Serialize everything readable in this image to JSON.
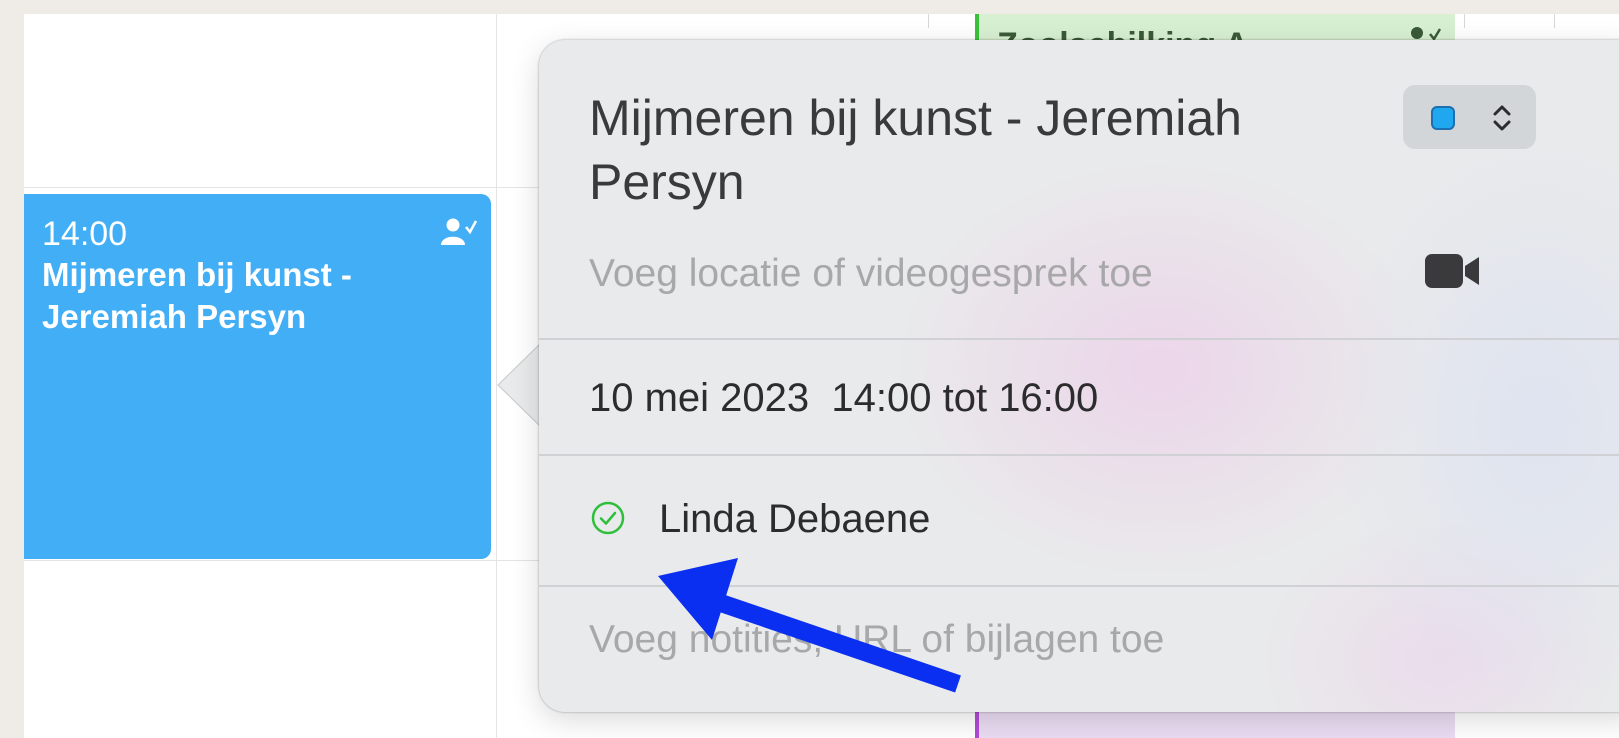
{
  "calendar": {
    "selected_event": {
      "time": "14:00",
      "title": "Mijmeren bij kunst - Jeremiah Persyn",
      "icon": "person-check-icon",
      "color": "#41aef5"
    },
    "other_event_top": {
      "title": "Zoolschilking A...",
      "color": "#3ac23a"
    }
  },
  "popover": {
    "title": "Mijmeren bij kunst - Jeremiah Persyn",
    "calendar_color": "#1fa7f0",
    "location_placeholder": "Voeg locatie of videogesprek toe",
    "date": "10 mei 2023",
    "time_range": "14:00 tot 16:00",
    "attendee": {
      "name": "Linda Debaene",
      "status": "accepted",
      "status_color": "#2fbf3c"
    },
    "notes_placeholder": "Voeg notities, URL of bijlagen toe"
  },
  "annotation": {
    "arrow_color": "#0a2ff0"
  }
}
